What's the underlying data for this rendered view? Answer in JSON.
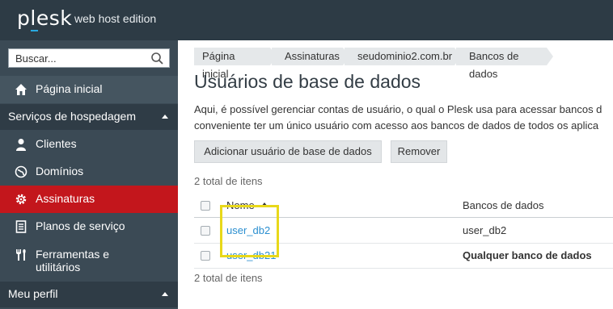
{
  "topbar": {
    "logo": "plesk",
    "edition": "web host edition",
    "bg_color": "#2d3b45"
  },
  "sidebar": {
    "search_placeholder": "Buscar...",
    "home": {
      "label": "Página inicial",
      "icon": "home-icon"
    },
    "section_hosting": "Serviços de hospedagem",
    "items": [
      {
        "label": "Clientes",
        "icon": "user-icon",
        "active": false
      },
      {
        "label": "Domínios",
        "icon": "globe-icon",
        "active": false
      },
      {
        "label": "Assinaturas",
        "icon": "gear-icon",
        "active": true
      },
      {
        "label": "Planos de serviço",
        "icon": "document-icon",
        "active": false
      },
      {
        "label": "Ferramentas e utilitários",
        "icon": "tools-icon",
        "active": false
      }
    ],
    "section_profile": "Meu perfil",
    "active_color": "#c3161c"
  },
  "main": {
    "breadcrumb": [
      "Página inicial",
      "Assinaturas",
      "seudominio2.com.br",
      "Bancos de dados"
    ],
    "title": "Usuários de base de dados",
    "description_line1": "Aqui, é possível gerenciar contas de usuário, o qual o Plesk usa para acessar bancos d",
    "description_line2": "conveniente ter um único usuário com acesso aos bancos de dados de todos os aplica",
    "buttons": {
      "add": "Adicionar usuário de base de dados",
      "remove": "Remover"
    },
    "total_top": "2 total de itens",
    "total_bottom": "2 total de itens",
    "table": {
      "columns": [
        "Nome",
        "Bancos de dados"
      ],
      "rows": [
        {
          "name": "user_db2",
          "databases": "user_db2",
          "bold": false
        },
        {
          "name": "user_db21",
          "databases": "Qualquer banco de dados",
          "bold": true
        }
      ]
    },
    "link_color": "#2b8fd0",
    "highlight_color": "#e8d81a"
  }
}
